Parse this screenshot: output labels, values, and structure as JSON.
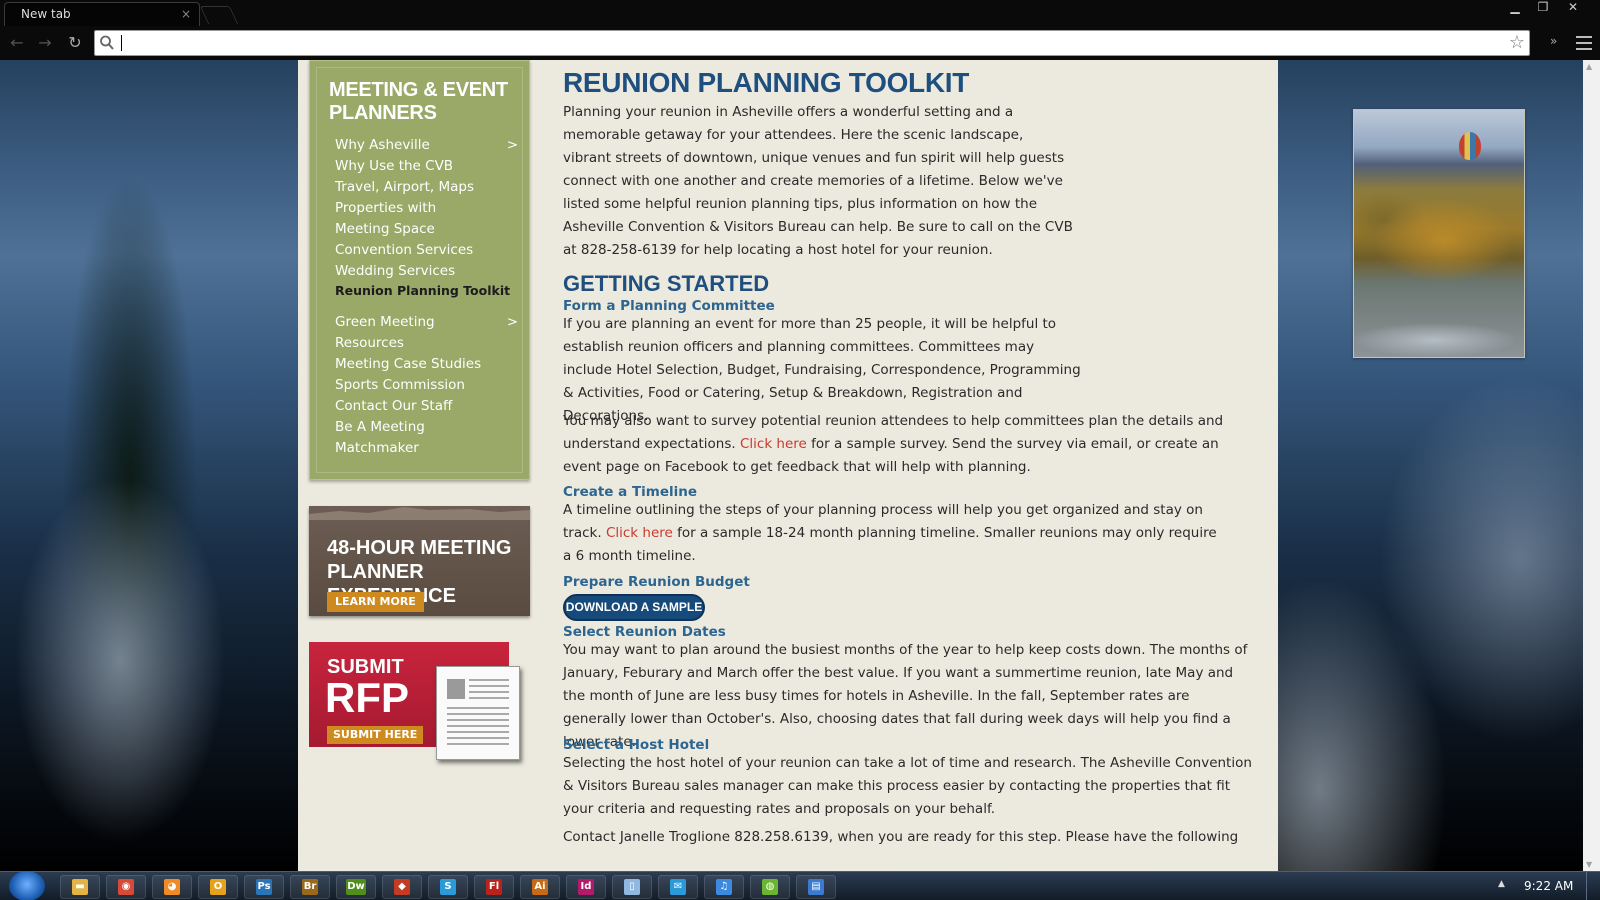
{
  "browser": {
    "tab_title": "New tab",
    "tab_close": "×",
    "window_controls": {
      "minimize": "▁",
      "restore": "❐",
      "close": "✕"
    },
    "omnibox_value": "",
    "ext_chevron": "»"
  },
  "sidebar": {
    "title": "MEETING & EVENT PLANNERS",
    "items": [
      {
        "label": "Why Asheville",
        "arrow": ">"
      },
      {
        "label": "Why Use the CVB"
      },
      {
        "label": "Travel, Airport, Maps"
      },
      {
        "label": "Properties with"
      },
      {
        "label": "Meeting Space"
      },
      {
        "label": "Convention Services"
      },
      {
        "label": "Wedding Services"
      },
      {
        "label": "Reunion Planning Toolkit",
        "active": true
      },
      {
        "label": "Green Meeting",
        "arrow": ">"
      },
      {
        "label": "Resources"
      },
      {
        "label": "Meeting Case Studies"
      },
      {
        "label": "Sports Commission"
      },
      {
        "label": "Contact Our Staff"
      },
      {
        "label": "Be A Meeting"
      },
      {
        "label": "Matchmaker"
      }
    ]
  },
  "promo_48": {
    "title": "48-HOUR MEETING PLANNER EXPERIENCE",
    "button": "LEARN MORE"
  },
  "promo_rfp": {
    "line1": "SUBMIT",
    "line2": "RFP",
    "button": "SUBMIT HERE"
  },
  "content": {
    "title": "REUNION PLANNING TOOLKIT",
    "intro": "Planning your reunion in Asheville offers a wonderful setting and a memorable getaway for your attendees. Here the scenic landscape, vibrant streets of downtown, unique venues and fun spirit will help guests connect with one another and create memories of a lifetime. Below we've listed some helpful reunion planning tips, plus information on how the Asheville Convention & Visitors Bureau can help. Be sure to call on the CVB at 828-258-6139 for help locating a host hotel for your reunion.",
    "getting_started": "GETTING STARTED",
    "committee_heading": "Form a Planning Committee",
    "committee_text": "If you are planning an event for more than 25 people, it will be helpful to establish reunion officers and planning committees. Committees may include Hotel Selection, Budget, Fundraising, Correspondence, Programming & Activities, Food or Catering, Setup & Breakdown, Registration and Decorations.",
    "survey_text_a": "You may also want to survey potential reunion attendees to help committees plan the details and understand expectations.",
    "survey_link": "Click here",
    "survey_text_b": "for a sample survey. Send the survey via email, or create an event page on Facebook to get feedback that will help with planning.",
    "timeline_heading": "Create a Timeline",
    "timeline_text_a": "A timeline outlining the steps of your planning process will help you get organized and stay on track.",
    "timeline_link": "Click here",
    "timeline_text_b": "for a sample 18-24 month planning timeline. Smaller reunions may only require a 6 month timeline.",
    "budget_heading": "Prepare Reunion Budget",
    "download_button": "DOWNLOAD A SAMPLE",
    "dates_heading": "Select Reunion Dates",
    "dates_text": "You may want to plan around the busiest months of the year to help keep costs down. The months of January, Feburary and March offer the best value. If you want a summertime reunion, late May and the month of June are less busy times for hotels in Asheville. In the fall, September rates are generally lower than October's. Also, choosing dates that fall during week days will help you find a lower rate.",
    "hotel_heading": "Select a Host Hotel",
    "hotel_text": "Selecting the host hotel of your reunion can take a lot of time and research. The Asheville Convention & Visitors Bureau sales manager can make this process easier by contacting the properties that fit your criteria and requesting rates and proposals on your behalf.",
    "contact_text": "Contact Janelle Troglione 828.258.6139, when you are ready for this step. Please have the following"
  },
  "taskbar": {
    "icons": [
      {
        "name": "explorer-icon",
        "glyph": "▬",
        "color": "#e3b343"
      },
      {
        "name": "chrome-icon",
        "glyph": "◉",
        "color": "#d84a38"
      },
      {
        "name": "firefox-icon",
        "glyph": "◕",
        "color": "#f08a24"
      },
      {
        "name": "outlook-icon",
        "glyph": "O",
        "color": "#e6a21a"
      },
      {
        "name": "photoshop-icon",
        "glyph": "Ps",
        "color": "#2a74b8"
      },
      {
        "name": "bridge-icon",
        "glyph": "Br",
        "color": "#9a6a1a"
      },
      {
        "name": "dreamweaver-icon",
        "glyph": "Dw",
        "color": "#4f8f1a"
      },
      {
        "name": "filezilla-icon",
        "glyph": "◆",
        "color": "#c43b24"
      },
      {
        "name": "skype-icon",
        "glyph": "S",
        "color": "#2a9ad8"
      },
      {
        "name": "flash-icon",
        "glyph": "Fl",
        "color": "#b8231c"
      },
      {
        "name": "illustrator-icon",
        "glyph": "Ai",
        "color": "#c86a13"
      },
      {
        "name": "indesign-icon",
        "glyph": "Id",
        "color": "#b31a6a"
      },
      {
        "name": "notes-icon",
        "glyph": "▯",
        "color": "#8fb7e0"
      },
      {
        "name": "messenger-icon",
        "glyph": "✉",
        "color": "#2a9ad8"
      },
      {
        "name": "itunes-icon",
        "glyph": "♫",
        "color": "#3a8ae0"
      },
      {
        "name": "spotify-icon",
        "glyph": "◍",
        "color": "#6ab630"
      },
      {
        "name": "window-icon",
        "glyph": "▤",
        "color": "#3a7ad0"
      }
    ],
    "clock": "9:22 AM",
    "tray_arrow": "▲"
  }
}
